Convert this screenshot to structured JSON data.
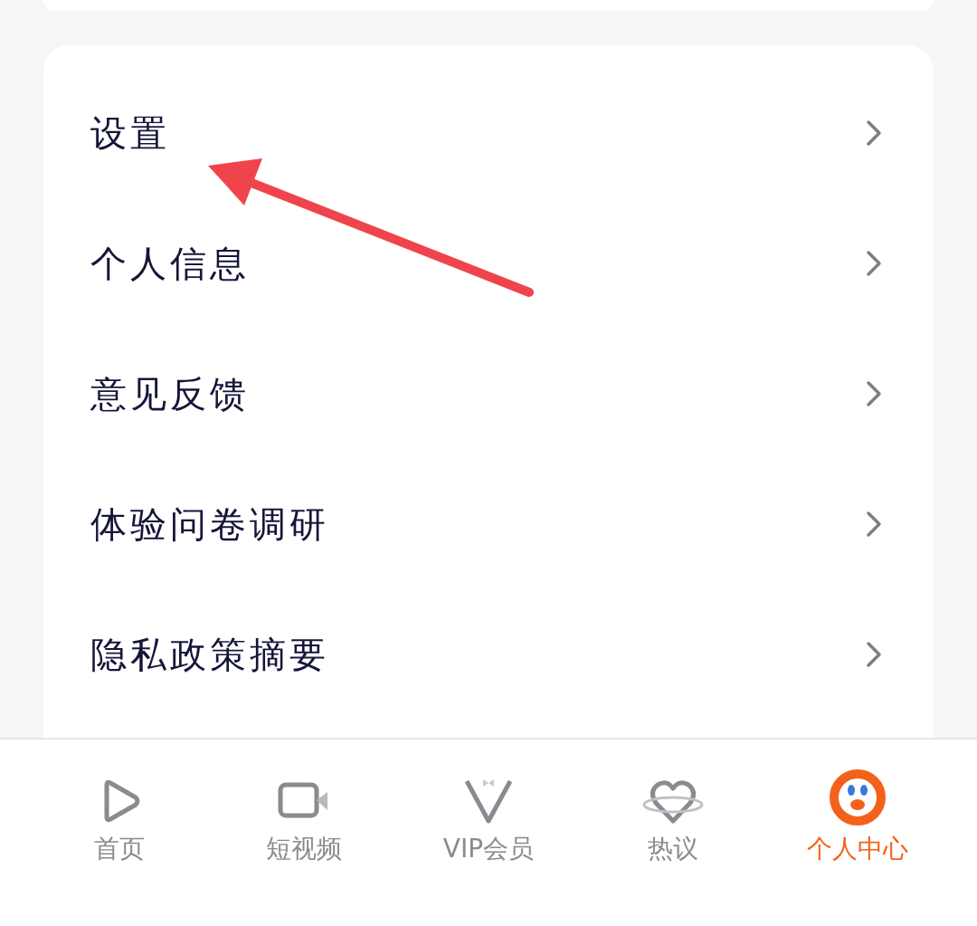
{
  "menu": [
    {
      "label": "设置"
    },
    {
      "label": "个人信息"
    },
    {
      "label": "意见反馈"
    },
    {
      "label": "体验问卷调研"
    },
    {
      "label": "隐私政策摘要"
    }
  ],
  "annotation": {
    "kind": "arrow"
  },
  "tabs": [
    {
      "label": "首页",
      "kind": "play",
      "selected": false
    },
    {
      "label": "短视频",
      "kind": "video",
      "selected": false
    },
    {
      "label": "VIP会员",
      "kind": "vip",
      "selected": false
    },
    {
      "label": "热议",
      "kind": "heart",
      "selected": false
    },
    {
      "label": "个人中心",
      "kind": "face",
      "selected": true
    }
  ]
}
